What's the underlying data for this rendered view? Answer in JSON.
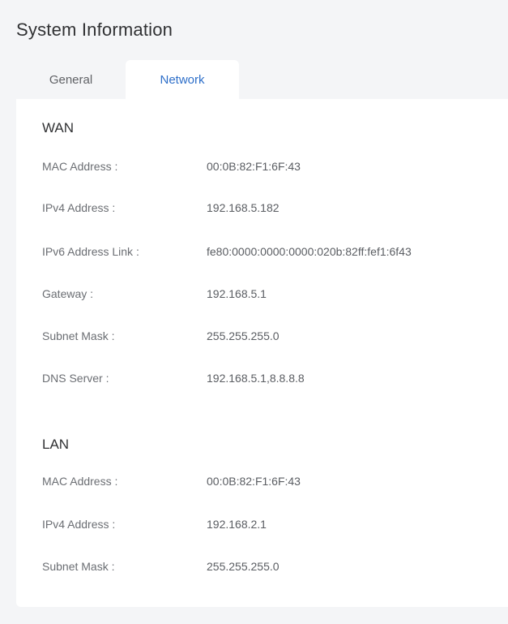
{
  "page": {
    "title": "System Information"
  },
  "tabs": [
    {
      "label": "General",
      "active": false
    },
    {
      "label": "Network",
      "active": true
    }
  ],
  "colors": {
    "background": "#f4f5f7",
    "panel": "#ffffff",
    "active_tab_text": "#2e6fc9",
    "label_text": "#6b6e73",
    "value_text": "#5a5d62"
  },
  "wan": {
    "title": "WAN",
    "rows": [
      {
        "label": "MAC Address :",
        "value": "00:0B:82:F1:6F:43"
      },
      {
        "label": "IPv4 Address :",
        "value": "192.168.5.182"
      },
      {
        "label": "IPv6 Address Link :",
        "value": "fe80:0000:0000:0000:020b:82ff:fef1:6f43"
      },
      {
        "label": "Gateway :",
        "value": "192.168.5.1"
      },
      {
        "label": "Subnet Mask :",
        "value": "255.255.255.0"
      },
      {
        "label": "DNS Server :",
        "value": "192.168.5.1,8.8.8.8"
      }
    ]
  },
  "lan": {
    "title": "LAN",
    "rows": [
      {
        "label": "MAC Address :",
        "value": "00:0B:82:F1:6F:43"
      },
      {
        "label": "IPv4 Address :",
        "value": "192.168.2.1"
      },
      {
        "label": "Subnet Mask :",
        "value": "255.255.255.0"
      }
    ]
  }
}
